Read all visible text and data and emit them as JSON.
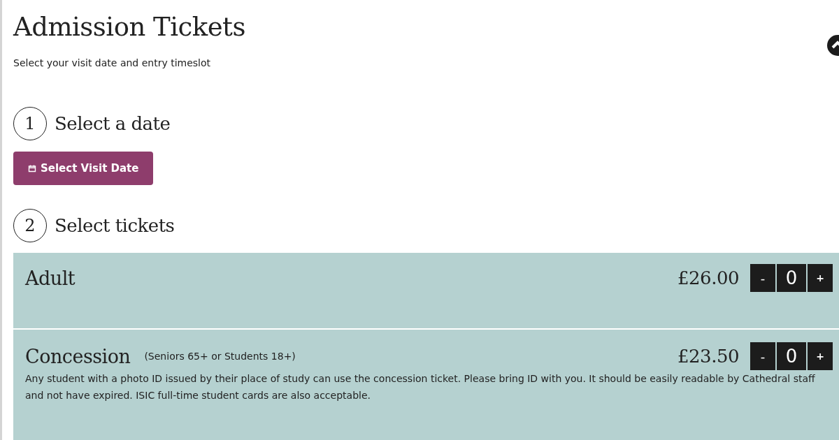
{
  "title": "Admission Tickets",
  "subtitle": "Select your visit date and entry timeslot",
  "steps": [
    {
      "number": "1",
      "heading": "Select a date"
    },
    {
      "number": "2",
      "heading": "Select tickets"
    }
  ],
  "date_button": {
    "label": "Select Visit Date"
  },
  "tickets": [
    {
      "name": "Adult",
      "price": "£26.00",
      "minus": "-",
      "quantity": "0",
      "plus": "+"
    },
    {
      "name": "Concession",
      "note": "(Seniors 65+ or Students 18+)",
      "price": "£23.50",
      "minus": "-",
      "quantity": "0",
      "plus": "+",
      "description": "Any student with a photo ID issued by their place of study can use the concession ticket. Please bring ID with you. It should be easily readable by Cathedral staff and not have expired. ISIC full-time student cards are also acceptable."
    }
  ]
}
